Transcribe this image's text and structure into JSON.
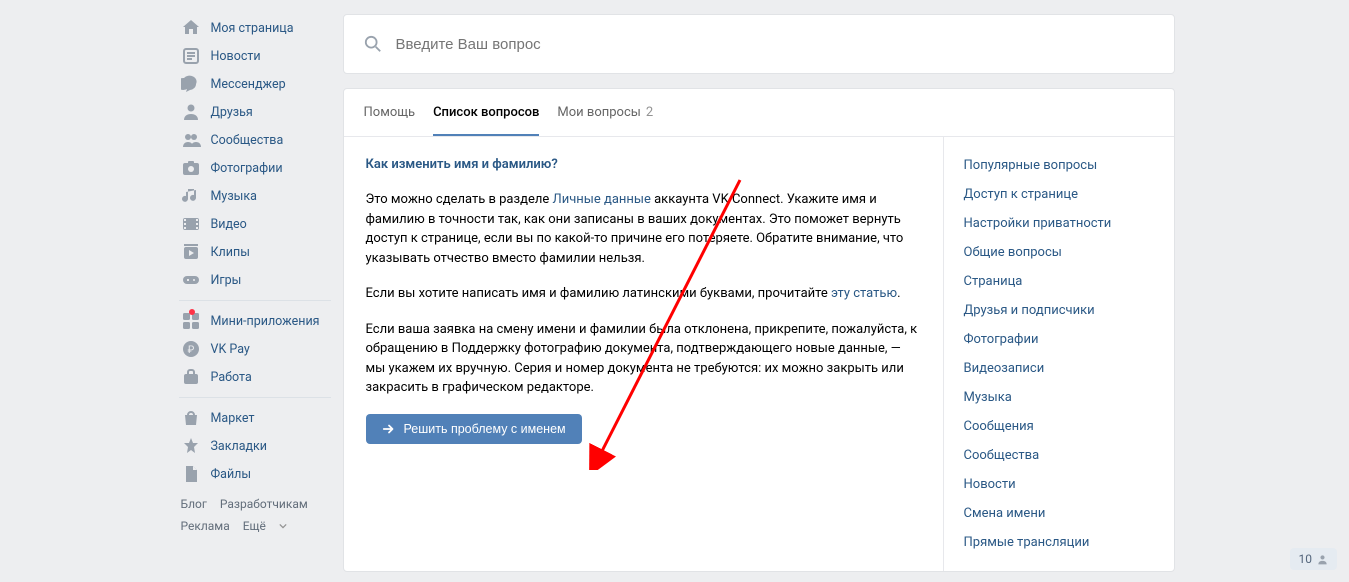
{
  "sidebar": {
    "groups": [
      [
        {
          "icon": "home",
          "label": "Моя страница"
        },
        {
          "icon": "news",
          "label": "Новости"
        },
        {
          "icon": "msg",
          "label": "Мессенджер"
        },
        {
          "icon": "friends",
          "label": "Друзья"
        },
        {
          "icon": "groups",
          "label": "Сообщества"
        },
        {
          "icon": "photo",
          "label": "Фотографии"
        },
        {
          "icon": "music",
          "label": "Музыка"
        },
        {
          "icon": "video",
          "label": "Видео"
        },
        {
          "icon": "clips",
          "label": "Клипы"
        },
        {
          "icon": "games",
          "label": "Игры"
        }
      ],
      [
        {
          "icon": "mini",
          "label": "Мини-приложения",
          "dot": true
        },
        {
          "icon": "vkpay",
          "label": "VK Pay"
        },
        {
          "icon": "work",
          "label": "Работа"
        }
      ],
      [
        {
          "icon": "market",
          "label": "Маркет"
        },
        {
          "icon": "bookmark",
          "label": "Закладки"
        },
        {
          "icon": "files",
          "label": "Файлы"
        }
      ]
    ],
    "footer": [
      "Блог",
      "Разработчикам",
      "Реклама",
      "Ещё"
    ]
  },
  "search": {
    "placeholder": "Введите Ваш вопрос"
  },
  "tabs": [
    {
      "label": "Помощь",
      "active": false
    },
    {
      "label": "Список вопросов",
      "active": true
    },
    {
      "label": "Мои вопросы",
      "count": "2",
      "active": false
    }
  ],
  "article": {
    "title": "Как изменить имя и фамилию?",
    "p1_a": "Это можно сделать в разделе ",
    "p1_link": "Личные данные",
    "p1_b": " аккаунта VK Connect. Укажите имя и фамилию в точности так, как они записаны в ваших документах. Это поможет вернуть доступ к странице, если вы по какой-то причине его потеряете. Обратите внимание, что указывать отчество вместо фамилии нельзя.",
    "p2_a": "Если вы хотите написать имя и фамилию латинскими буквами, прочитайте ",
    "p2_link": "эту статью",
    "p2_b": ".",
    "p3": "Если ваша заявка на смену имени и фамилии была отклонена, прикрепите, пожалуйста, к обращению в Поддержку фотографию документа, подтверждающего новые данные, — мы укажем их вручную. Серия и номер документа не требуются: их можно закрыть или закрасить в графическом редакторе.",
    "button": "Решить проблему с именем"
  },
  "aside_links": [
    "Популярные вопросы",
    "Доступ к странице",
    "Настройки приватности",
    "Общие вопросы",
    "Страница",
    "Друзья и подписчики",
    "Фотографии",
    "Видеозаписи",
    "Музыка",
    "Сообщения",
    "Сообщества",
    "Новости",
    "Смена имени",
    "Прямые трансляции"
  ],
  "notif_count": "10"
}
